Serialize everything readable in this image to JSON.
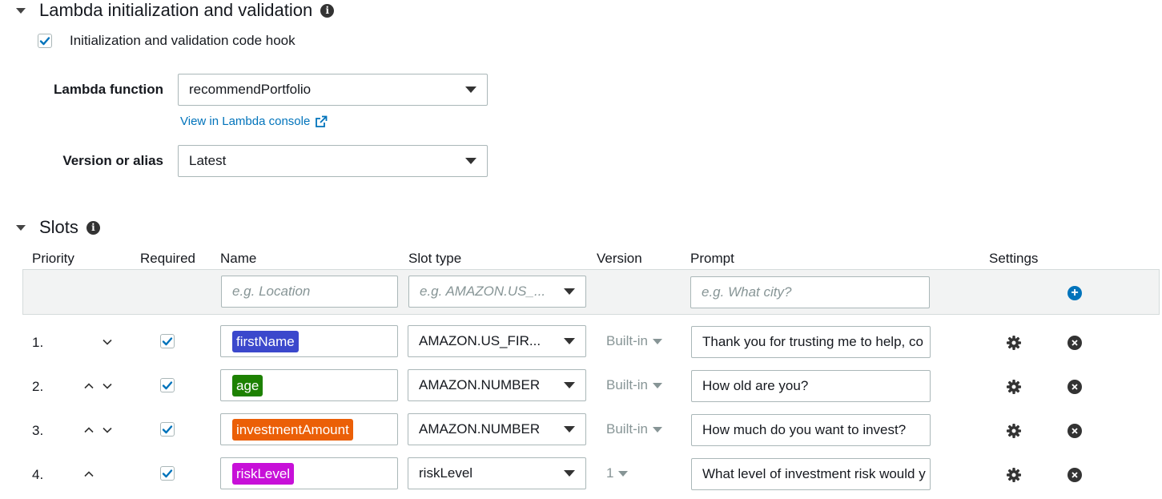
{
  "lambda_section": {
    "title": "Lambda initialization and validation",
    "hook_checkbox_label": "Initialization and validation code hook",
    "hook_checked": true,
    "lambda_function_label": "Lambda function",
    "lambda_function_value": "recommendPortfolio",
    "view_link": "View in Lambda console",
    "version_label": "Version or alias",
    "version_value": "Latest"
  },
  "slots_section": {
    "title": "Slots",
    "columns": {
      "priority": "Priority",
      "required": "Required",
      "name": "Name",
      "slot_type": "Slot type",
      "version": "Version",
      "prompt": "Prompt",
      "settings": "Settings"
    },
    "new_slot": {
      "name_placeholder": "e.g. Location",
      "type_placeholder": "e.g. AMAZON.US_...",
      "prompt_placeholder": "e.g. What city?"
    },
    "rows": [
      {
        "priority": "1.",
        "required": true,
        "name": "firstName",
        "color": "#3b48cc",
        "slot_type": "AMAZON.US_FIR...",
        "version": "Built-in",
        "prompt": "Thank you for trusting me to help, co"
      },
      {
        "priority": "2.",
        "required": true,
        "name": "age",
        "color": "#1d8102",
        "slot_type": "AMAZON.NUMBER",
        "version": "Built-in",
        "prompt": "How old are you?"
      },
      {
        "priority": "3.",
        "required": true,
        "name": "investmentAmount",
        "color": "#eb5f07",
        "slot_type": "AMAZON.NUMBER",
        "version": "Built-in",
        "prompt": "How much do you want to invest?"
      },
      {
        "priority": "4.",
        "required": true,
        "name": "riskLevel",
        "color": "#c710d8",
        "slot_type": "riskLevel",
        "version": "1",
        "prompt": "What level of investment risk would y"
      }
    ]
  }
}
